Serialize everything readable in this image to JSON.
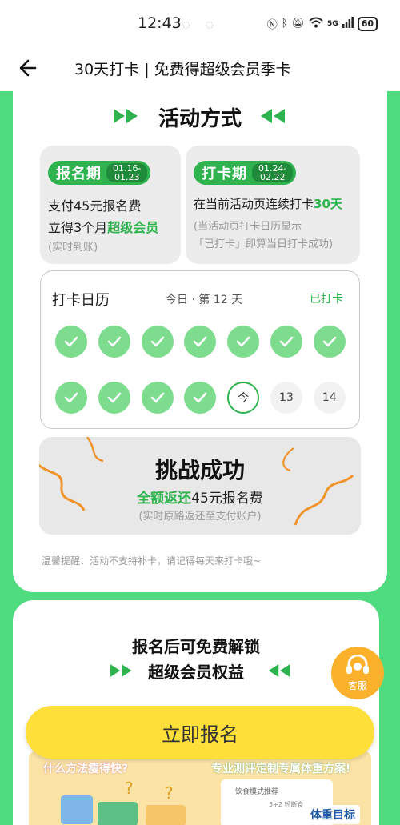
{
  "status_bar": {
    "time": "12:43",
    "battery": "60",
    "signal": "5G"
  },
  "nav": {
    "title": "30天打卡 | 免费得超级会员季卡"
  },
  "activity": {
    "heading": "活动方式",
    "signup": {
      "label": "报名期",
      "date_start": "01.16-",
      "date_end": "01.23",
      "line1": "支付45元报名费",
      "line2_prefix": "立得3个月",
      "line2_highlight": "超级会员",
      "note": "(实时到账)"
    },
    "checkin": {
      "label": "打卡期",
      "date_start": "01.24-",
      "date_end": "02.22",
      "line1_prefix": "在当前活动页连续打卡",
      "line1_highlight": "30天",
      "note1": "(当活动页打卡日历显示",
      "note2": "「已打卡」即算当日打卡成功)"
    }
  },
  "calendar": {
    "title": "打卡日历",
    "day_info": "今日 · 第 12 天",
    "status": "已打卡",
    "days": [
      {
        "state": "checked"
      },
      {
        "state": "checked"
      },
      {
        "state": "checked"
      },
      {
        "state": "checked"
      },
      {
        "state": "checked"
      },
      {
        "state": "checked"
      },
      {
        "state": "checked"
      },
      {
        "state": "checked"
      },
      {
        "state": "checked"
      },
      {
        "state": "checked"
      },
      {
        "state": "checked"
      },
      {
        "state": "today",
        "label": "今"
      },
      {
        "state": "future",
        "label": "13"
      },
      {
        "state": "future",
        "label": "14"
      }
    ]
  },
  "success": {
    "title": "挑战成功",
    "sub_highlight": "全额返还",
    "sub_rest": "45元报名费",
    "note": "(实时原路返还至支付账户)"
  },
  "reminder": "温馨提醒：活动不支持补卡，请记得每天来打卡哦~",
  "benefits": {
    "line1": "报名后可免费解锁",
    "line2": "超级会员权益"
  },
  "promo": {
    "question": "什么方法瘦得快?",
    "slogan": "专业测评定制专属体重方案!",
    "card_title": "饮食模式推荐",
    "card_option": "5+2 轻断食",
    "weight_tag": "体重目标"
  },
  "cta": {
    "label": "立即报名"
  },
  "service": {
    "label": "客服"
  },
  "colors": {
    "green": "#2fb34f",
    "bg_green": "#4fdc80",
    "yellow": "#ffe03a",
    "orange": "#fbb12c"
  }
}
